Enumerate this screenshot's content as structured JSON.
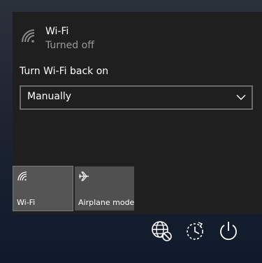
{
  "wifi": {
    "title": "Wi-Fi",
    "status": "Turned off"
  },
  "turn_on": {
    "label": "Turn Wi-Fi back on",
    "selected": "Manually"
  },
  "quick_actions": [
    {
      "label": "Wi-Fi",
      "icon": "wifi-icon",
      "state": "off"
    },
    {
      "label": "Airplane mode",
      "icon": "airplane-icon",
      "state": "off"
    }
  ],
  "tray": [
    {
      "icon": "network-settings-icon"
    },
    {
      "icon": "sleep-timer-icon"
    },
    {
      "icon": "power-icon"
    }
  ],
  "colors": {
    "panel": "#1f1f1f",
    "tile": "#505050",
    "muted_text": "#9a9a9a"
  }
}
